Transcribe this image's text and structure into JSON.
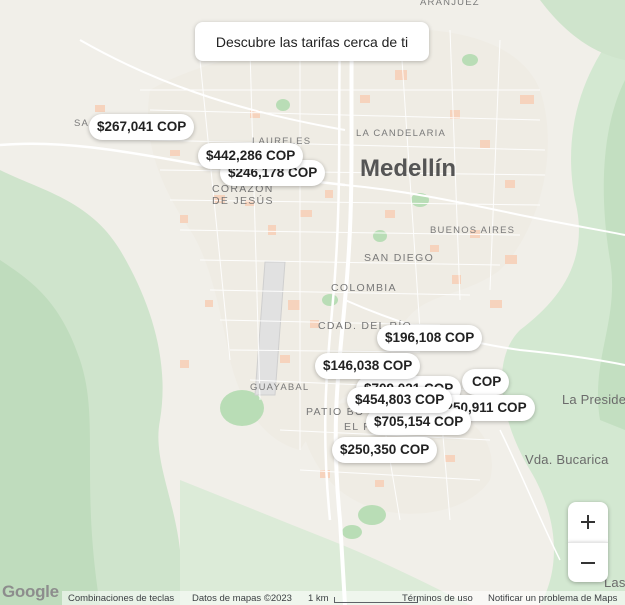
{
  "banner": {
    "label": "Descubre las tarifas cerca de ti"
  },
  "places": {
    "city": "Medellín",
    "la_candelaria": "LA CANDELARIA",
    "laureles": "LAURELES",
    "corazon_1": "CORAZÓN",
    "corazon_2": "DE JESÚS",
    "buenos_aires": "BUENOS AIRES",
    "san_diego": "SAN DIEGO",
    "colombia": "COLOMBIA",
    "cdad_del_rio": "CDAD. DEL RÍO",
    "guayabal": "GUAYABAL",
    "patio_bonito": "PATIO BO",
    "el_poblado": "EL P",
    "la_presidenta": "La Preside",
    "vda_bucarica": "Vda. Bucarica",
    "aranjuez": "ARANJUEZ",
    "san_edge": "SA",
    "las": "Las"
  },
  "prices": [
    "$267,041 COP",
    "$442,286 COP",
    "$246,178 COP",
    "$196,108 COP",
    "$146,038 COP",
    "$709,021 COP",
    "$454,803 COP",
    "$705,154 COP",
    "$250,350 COP",
    "$250,911 COP",
    "COP"
  ],
  "controls": {
    "zoom_in": "+",
    "zoom_out": "−"
  },
  "footer": {
    "logo": "Google",
    "shortcuts": "Combinaciones de teclas",
    "map_data": "Datos de mapas ©2023",
    "scale": "1 km",
    "terms": "Términos de uso",
    "report": "Notificar un problema de Maps"
  },
  "colors": {
    "land": "#f1efe9",
    "green": "#cfe6cf",
    "park": "#b8dcb5",
    "urban": "#f5dccd",
    "road": "#ffffff"
  }
}
